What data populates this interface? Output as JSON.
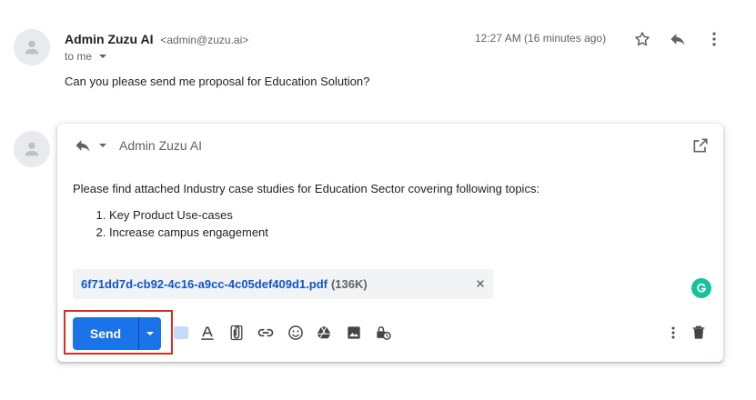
{
  "message": {
    "sender_name": "Admin Zuzu AI",
    "sender_email": "<admin@zuzu.ai>",
    "to_label": "to me",
    "timestamp": "12:27 AM (16 minutes ago)",
    "body": "Can you please send me proposal for Education Solution?"
  },
  "reply": {
    "recipient": "Admin Zuzu AI",
    "intro": "Please find attached Industry case studies for Education Sector covering following topics:",
    "topics": [
      "Key Product Use-cases",
      "Increase campus engagement"
    ],
    "attachment": {
      "filename": "6f71dd7d-cb92-4c16-a9cc-4c05def409d1.pdf",
      "size": "(136K)"
    },
    "send_label": "Send"
  },
  "colors": {
    "accent": "#1a73e8",
    "link": "#1155cc",
    "highlight": "#d93025",
    "grammarly": "#15c39a"
  },
  "icons": [
    "person-icon",
    "star-icon",
    "reply-icon",
    "more-vert-icon",
    "popout-icon",
    "close-icon",
    "grammarly-icon",
    "format-text-icon",
    "attach-icon",
    "link-icon",
    "emoji-icon",
    "drive-icon",
    "photo-icon",
    "confidential-icon",
    "delete-icon"
  ]
}
